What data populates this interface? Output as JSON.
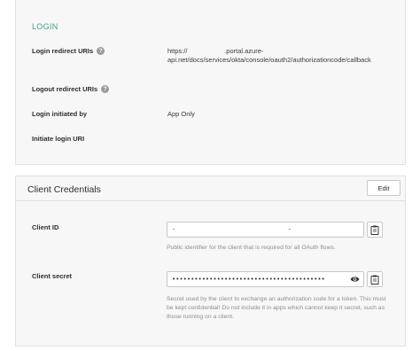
{
  "login": {
    "heading": "LOGIN",
    "rows": {
      "redirect": {
        "label": "Login redirect URIs",
        "value_line1": "https://                    .portal.azure-",
        "value_line2": "api.net/docs/services/okta/console/oauth2/authorizationcode/callback"
      },
      "logout": {
        "label": "Logout redirect URIs"
      },
      "initiated": {
        "label": "Login initiated by",
        "value": "App Only"
      },
      "initiate_uri": {
        "label": "Initiate login URI"
      }
    },
    "help_glyph": "?"
  },
  "credentials": {
    "title": "Client Credentials",
    "edit_label": "Edit",
    "client_id": {
      "label": "Client ID",
      "value": "-                              -",
      "hint": "Public identifier for the client that is required for all OAuth flows."
    },
    "client_secret": {
      "label": "Client secret",
      "value": "•••••••••••••••••••••••••••••••••••••••••",
      "hint": "Secret used by the client to exchange an authorization code for a token. This must be kept confidential! Do not include it in apps which cannot keep it secret, such as those running on a client."
    }
  },
  "icons": [
    "help-icon",
    "clipboard-icon",
    "eye-icon"
  ]
}
